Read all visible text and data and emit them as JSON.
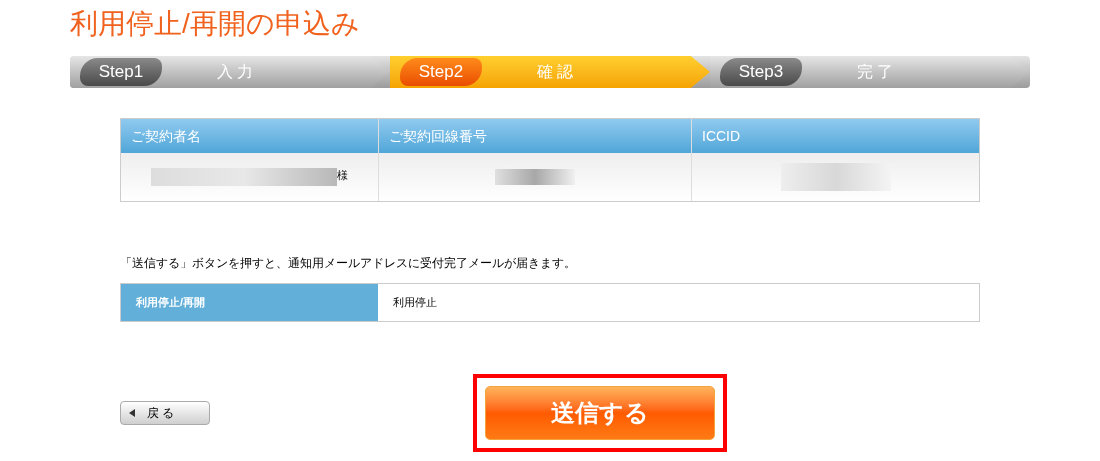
{
  "title": "利用停止/再開の申込み",
  "steps": [
    {
      "step": "Step1",
      "label": "入 力",
      "selected": false
    },
    {
      "step": "Step2",
      "label": "確 認",
      "selected": true
    },
    {
      "step": "Step3",
      "label": "完 了",
      "selected": false
    }
  ],
  "contract_table": {
    "columns": [
      "ご契約者名",
      "ご契約回線番号",
      "ICCID"
    ],
    "row": [
      {
        "kind": "redacted",
        "suffix": "様"
      },
      {
        "kind": "redacted"
      },
      {
        "kind": "redacted"
      }
    ]
  },
  "notice": "「送信する」ボタンを押すと、通知用メールアドレスに受付完了メールが届きます。",
  "request_table": {
    "label": "利用停止/再開",
    "value": "利用停止"
  },
  "back_button": "戻 る",
  "submit_button": {
    "label": "送信する",
    "highlighted": true
  }
}
